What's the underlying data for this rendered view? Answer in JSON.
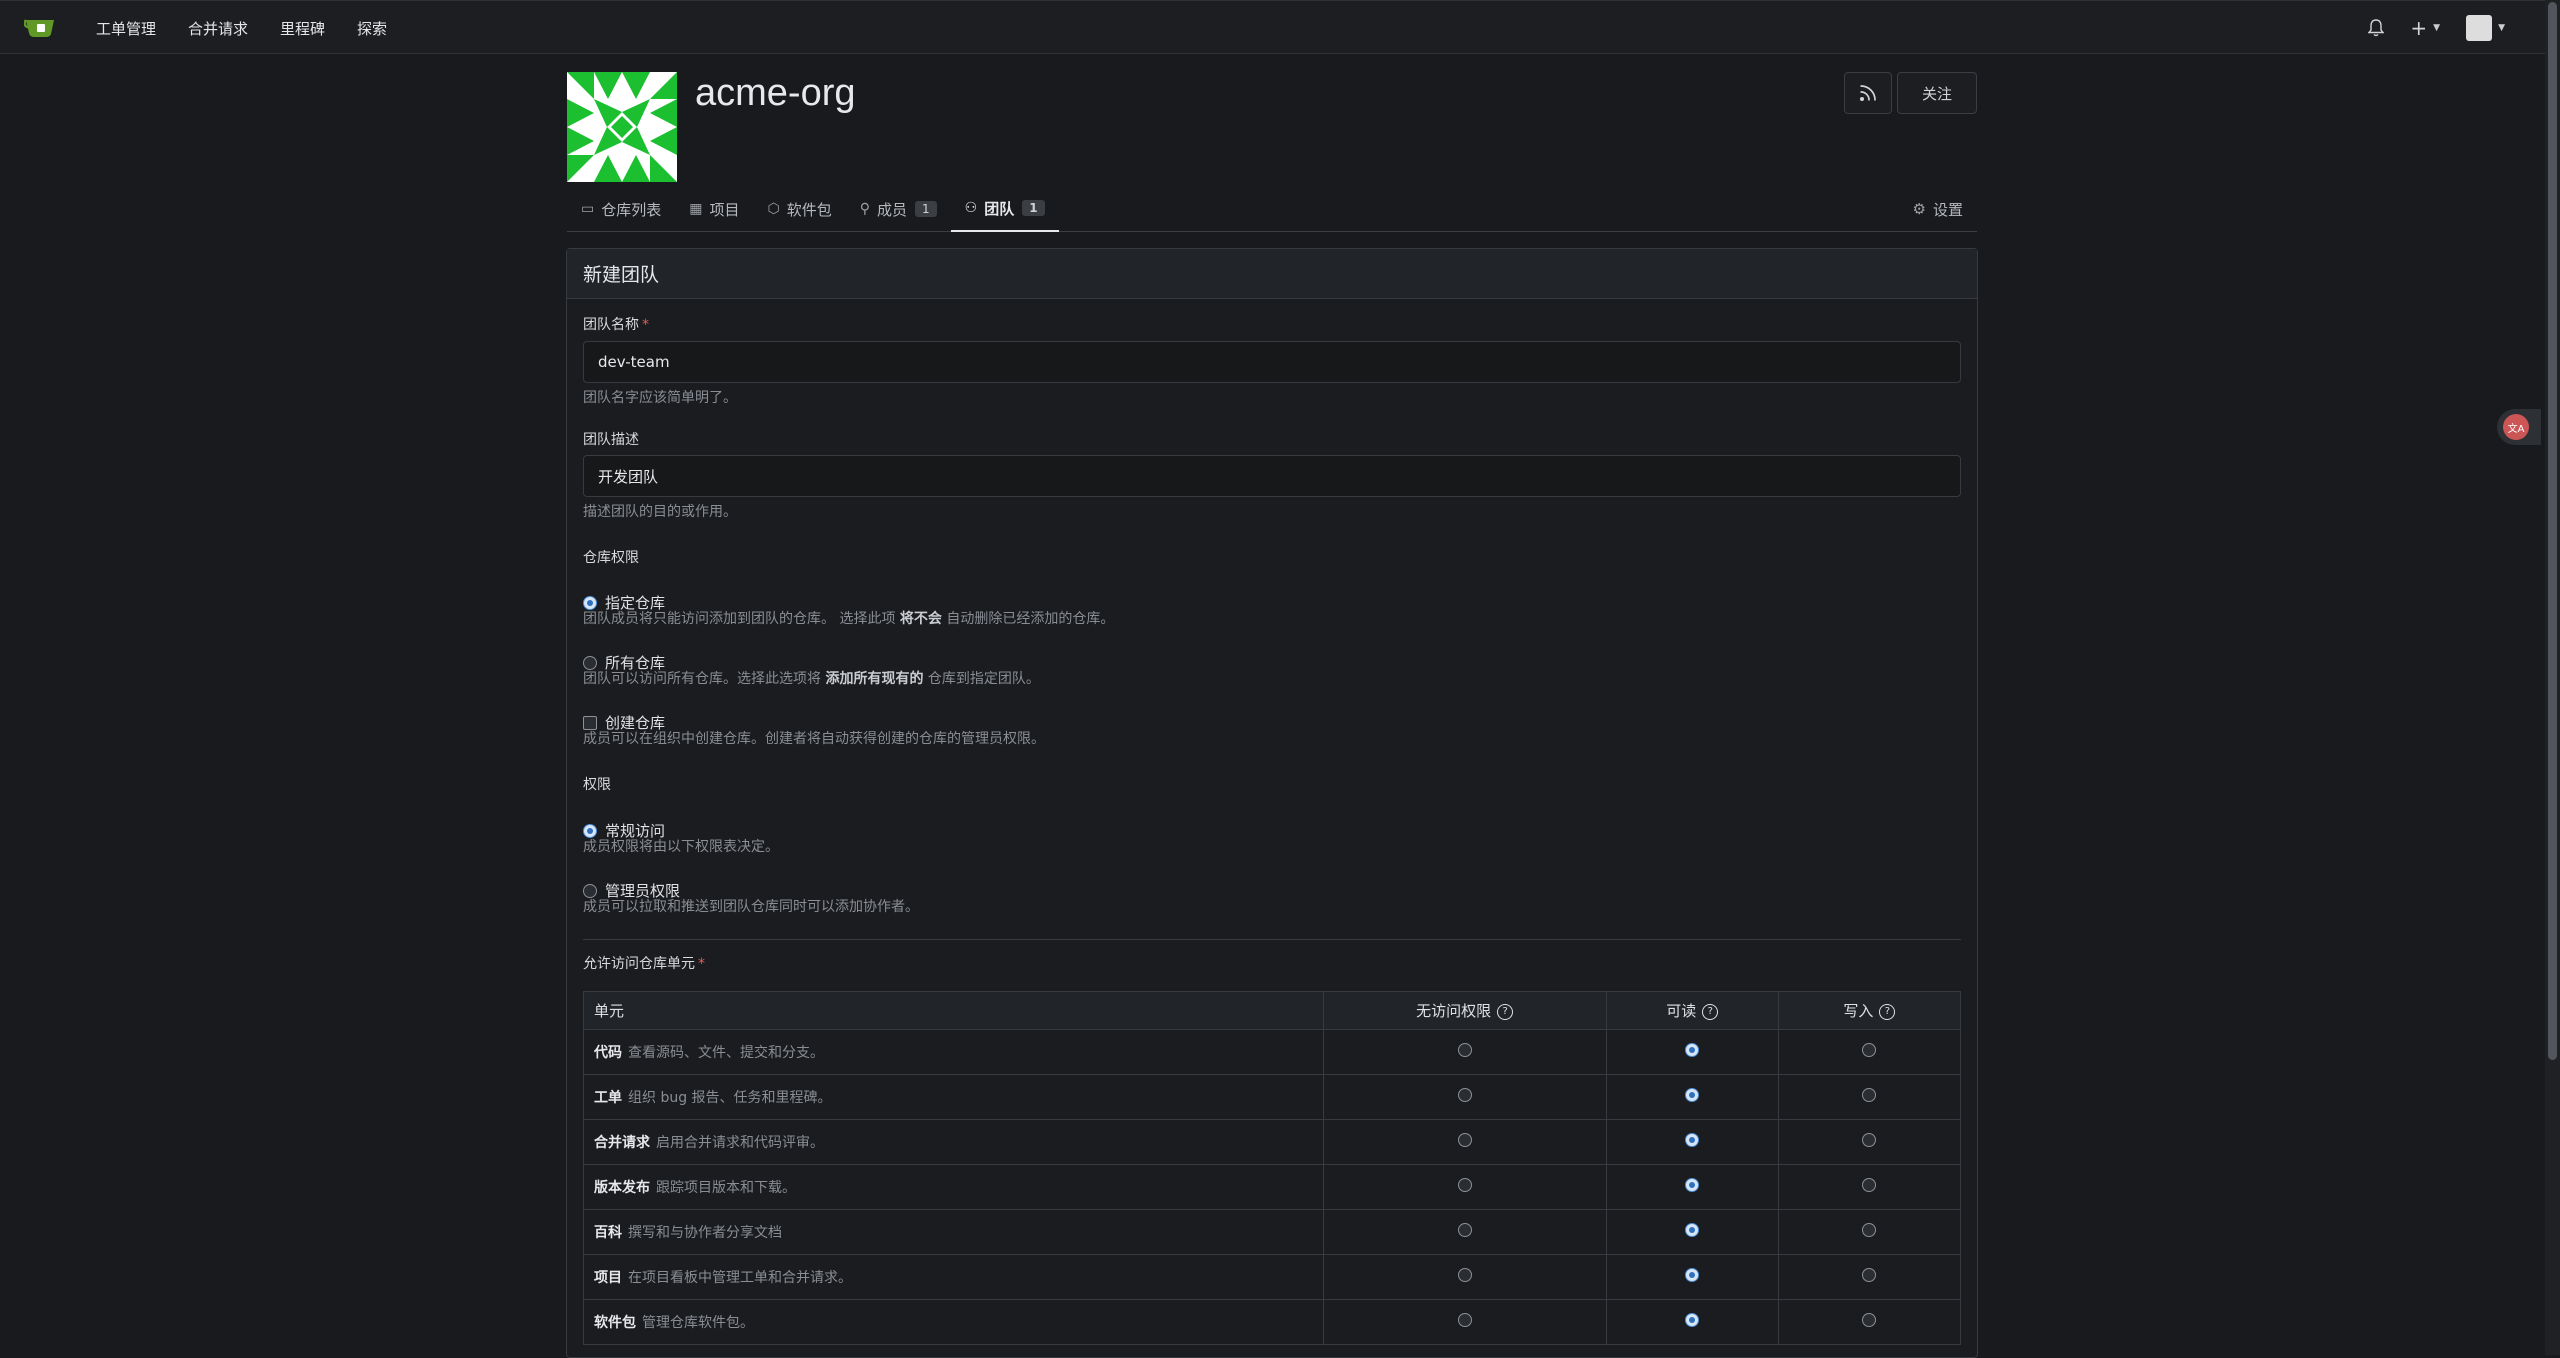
{
  "nav": {
    "items": [
      "工单管理",
      "合并请求",
      "里程碑",
      "探索"
    ]
  },
  "org": {
    "name": "acme-org",
    "follow_label": "关注"
  },
  "tabs": [
    {
      "label": "仓库列表",
      "icon": "repo-icon"
    },
    {
      "label": "项目",
      "icon": "project-icon"
    },
    {
      "label": "软件包",
      "icon": "package-icon"
    },
    {
      "label": "成员",
      "icon": "person-icon",
      "count": "1"
    },
    {
      "label": "团队",
      "icon": "people-icon",
      "count": "1",
      "active": true
    }
  ],
  "settings_label": "设置",
  "form": {
    "title": "新建团队",
    "team_name_label": "团队名称",
    "team_name_value": "dev-team",
    "team_name_help": "团队名字应该简单明了。",
    "desc_label": "团队描述",
    "desc_value": "开发团队",
    "desc_help": "描述团队的目的或作用。",
    "repo_access_label": "仓库权限",
    "repo_specific": {
      "label": "指定仓库",
      "desc_pre": "团队成员将只能访问添加到团队的仓库。 选择此项 ",
      "desc_bold": "将不会",
      "desc_post": " 自动删除已经添加的仓库。"
    },
    "repo_all": {
      "label": "所有仓库",
      "desc_pre": "团队可以访问所有仓库。选择此选项将 ",
      "desc_bold": "添加所有现有的",
      "desc_post": " 仓库到指定团队。"
    },
    "repo_create": {
      "label": "创建仓库",
      "desc": "成员可以在组织中创建仓库。创建者将自动获得创建的仓库的管理员权限。"
    },
    "perm_label": "权限",
    "perm_normal": {
      "label": "常规访问",
      "desc": "成员权限将由以下权限表决定。"
    },
    "perm_admin": {
      "label": "管理员权限",
      "desc": "成员可以拉取和推送到团队仓库同时可以添加协作者。"
    },
    "units_label": "允许访问仓库单元",
    "table_headers": {
      "unit": "单元",
      "none": "无访问权限",
      "read": "可读",
      "write": "写入"
    },
    "units": [
      {
        "name": "代码",
        "desc": "查看源码、文件、提交和分支。",
        "selected": "read"
      },
      {
        "name": "工单",
        "desc": "组织 bug 报告、任务和里程碑。",
        "selected": "read"
      },
      {
        "name": "合并请求",
        "desc": "启用合并请求和代码评审。",
        "selected": "read"
      },
      {
        "name": "版本发布",
        "desc": "跟踪项目版本和下载。",
        "selected": "read"
      },
      {
        "name": "百科",
        "desc": "撰写和与协作者分享文档",
        "selected": "read"
      },
      {
        "name": "项目",
        "desc": "在项目看板中管理工单和合并请求。",
        "selected": "read"
      },
      {
        "name": "软件包",
        "desc": "管理仓库软件包。",
        "selected": "read"
      }
    ]
  },
  "colors": {
    "background": "#181a1d",
    "accent": "#2f6fbf",
    "logo_green": "#609926"
  }
}
